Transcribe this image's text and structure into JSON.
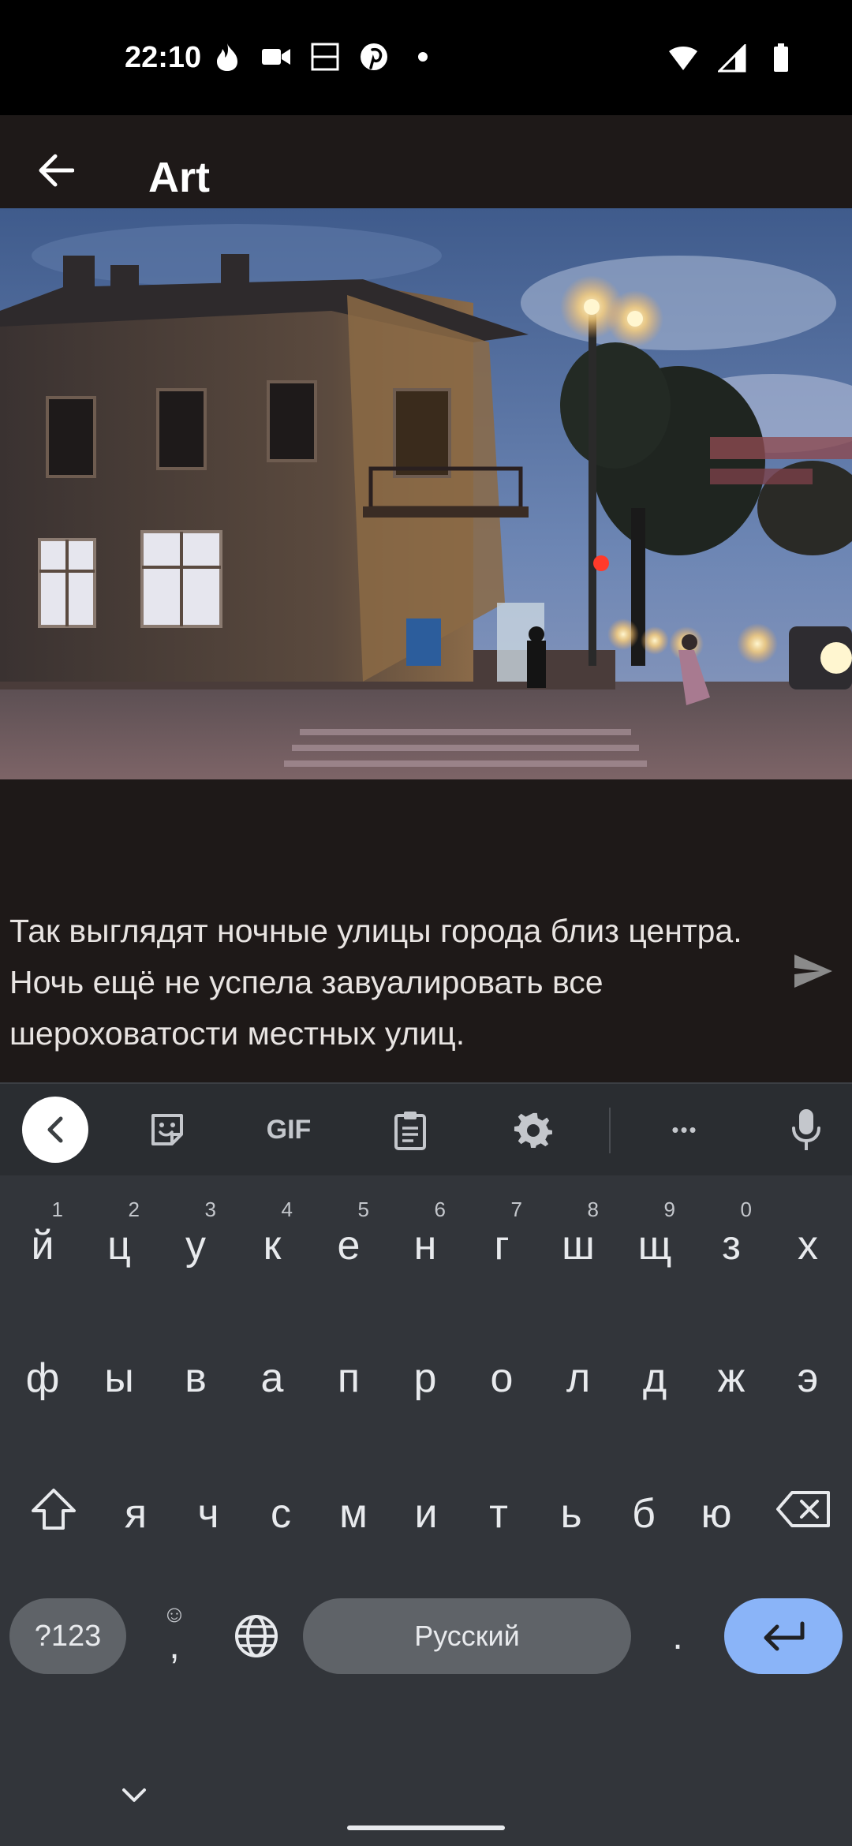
{
  "status_bar": {
    "time": "22:10",
    "left_icons": [
      "flame-icon",
      "video-camera-icon",
      "screen-split-icon",
      "pinterest-icon",
      "dot-icon"
    ],
    "right_icons": [
      "wifi-icon",
      "signal-icon",
      "battery-icon"
    ]
  },
  "app_bar": {
    "title": "Art",
    "back_icon": "back-arrow-icon"
  },
  "photo": {
    "description_icon": "street-photo"
  },
  "caption": {
    "text": "Так выглядят ночные улицы города близ центра. Ночь ещё не успела завуалировать все шероховатости местных улиц."
  },
  "send_icon": "send-icon",
  "keyboard": {
    "toolbar": [
      "collapse-icon",
      "sticker-icon",
      "gif-label",
      "clipboard-icon",
      "settings-icon",
      "more-icon",
      "mic-icon"
    ],
    "gif_label": "GIF",
    "more_label": "•••",
    "row1": [
      {
        "letter": "й",
        "hint": "1"
      },
      {
        "letter": "ц",
        "hint": "2"
      },
      {
        "letter": "у",
        "hint": "3"
      },
      {
        "letter": "к",
        "hint": "4"
      },
      {
        "letter": "е",
        "hint": "5"
      },
      {
        "letter": "н",
        "hint": "6"
      },
      {
        "letter": "г",
        "hint": "7"
      },
      {
        "letter": "ш",
        "hint": "8"
      },
      {
        "letter": "щ",
        "hint": "9"
      },
      {
        "letter": "з",
        "hint": "0"
      },
      {
        "letter": "х",
        "hint": ""
      }
    ],
    "row2": [
      "ф",
      "ы",
      "в",
      "а",
      "п",
      "р",
      "о",
      "л",
      "д",
      "ж",
      "э"
    ],
    "row3": [
      "я",
      "ч",
      "с",
      "м",
      "и",
      "т",
      "ь",
      "б",
      "ю"
    ],
    "symbols_label": "?123",
    "comma_label": ",",
    "emoji_hint": "☺",
    "space_label": "Русский",
    "period_label": "."
  },
  "colors": {
    "accent_enter": "#8ab4f8",
    "keyboard_bg": "#32353a",
    "app_bg": "#1e1918"
  }
}
